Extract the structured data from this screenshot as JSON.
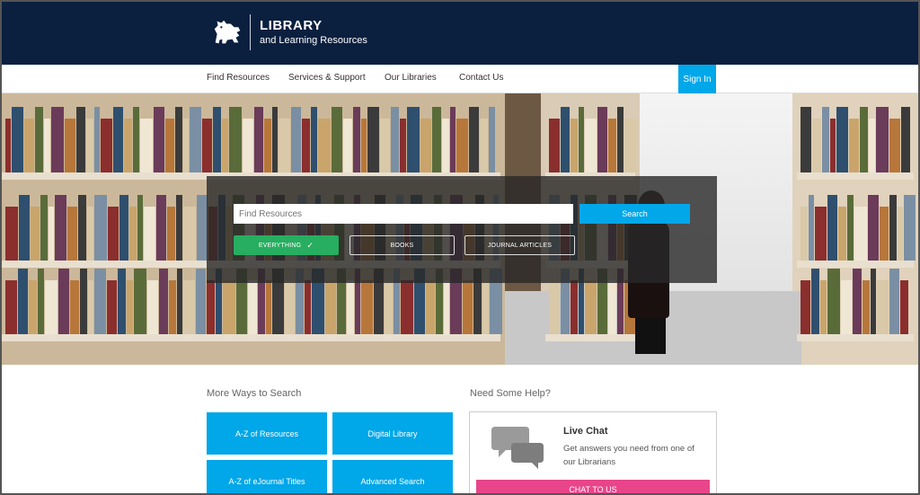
{
  "header": {
    "logo_title": "LIBRARY",
    "logo_subtitle": "and Learning Resources"
  },
  "nav": {
    "items": [
      {
        "label": "Find Resources"
      },
      {
        "label": "Services & Support"
      },
      {
        "label": "Our Libraries"
      },
      {
        "label": "Contact Us"
      }
    ],
    "sign_in": "Sign In"
  },
  "search": {
    "placeholder": "Find Resources",
    "button_label": "Search",
    "filters": [
      {
        "label": "EVERYTHING",
        "active": true
      },
      {
        "label": "BOOKS",
        "active": false
      },
      {
        "label": "JOURNAL ARTICLES",
        "active": false
      }
    ],
    "check_glyph": "✓"
  },
  "more_ways": {
    "title": "More Ways to Search",
    "tiles": [
      {
        "label": "A-Z of Resources"
      },
      {
        "label": "Digital Library"
      },
      {
        "label": "A-Z of eJournal Titles"
      },
      {
        "label": "Advanced Search"
      }
    ]
  },
  "help": {
    "title": "Need Some Help?",
    "chat_title": "Live Chat",
    "chat_description": "Get answers you need from one of our Librarians",
    "chat_button": "CHAT TO US"
  },
  "colors": {
    "header_bg": "#0b1f3f",
    "accent_blue": "#00a7e9",
    "active_green": "#27ae60",
    "chat_pink": "#e8458b"
  },
  "icons": {
    "logo": "lion-crest-icon",
    "chat": "speech-bubbles-icon"
  }
}
